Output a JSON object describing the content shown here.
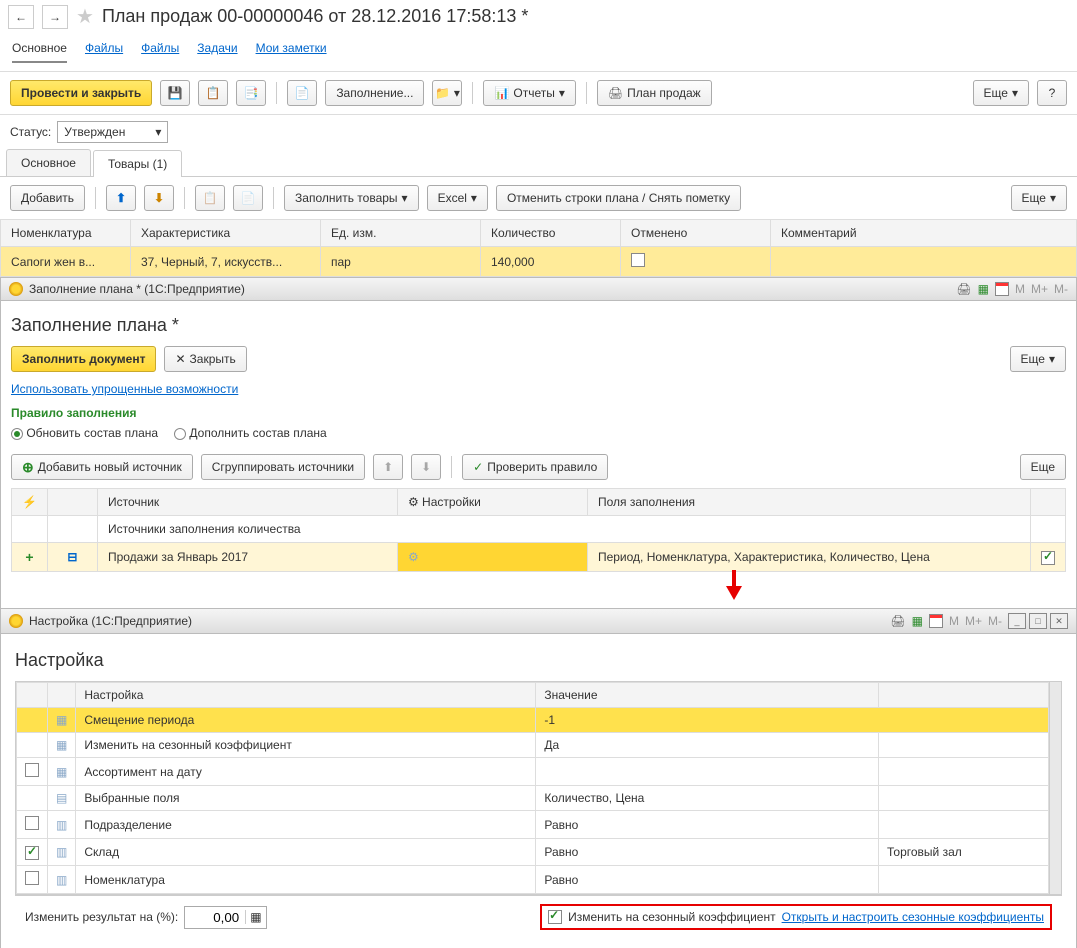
{
  "header": {
    "title": "План продаж 00-00000046 от 28.12.2016 17:58:13 *"
  },
  "sections": {
    "main": "Основное",
    "files1": "Файлы",
    "files2": "Файлы",
    "tasks": "Задачи",
    "notes": "Мои заметки"
  },
  "toolbar1": {
    "post_close": "Провести и закрыть",
    "fill": "Заполнение...",
    "reports": "Отчеты",
    "plan": "План продаж",
    "more": "Еще",
    "help": "?"
  },
  "status": {
    "label": "Статус:",
    "value": "Утвержден"
  },
  "tabs": {
    "main": "Основное",
    "goods": "Товары (1)"
  },
  "goods_toolbar": {
    "add": "Добавить",
    "fill_goods": "Заполнить товары",
    "excel": "Excel",
    "cancel_rows": "Отменить строки плана / Снять пометку",
    "more": "Еще"
  },
  "goods_cols": {
    "nomen": "Номенклатура",
    "char": "Характеристика",
    "unit": "Ед. изм.",
    "qty": "Количество",
    "cancelled": "Отменено",
    "comment": "Комментарий"
  },
  "goods_row": {
    "nomen": "Сапоги жен в...",
    "char": "37, Черный, 7, искусств...",
    "unit": "пар",
    "qty": "140,000"
  },
  "modal1": {
    "title": "Заполнение плана * (1С:Предприятие)",
    "heading": "Заполнение плана *",
    "fill_doc": "Заполнить документ",
    "close": "Закрыть",
    "more": "Еще",
    "simple": "Использовать упрощенные возможности",
    "rule": "Правило заполнения",
    "opt1": "Обновить состав плана",
    "opt2": "Дополнить состав плана",
    "add_src": "Добавить новый источник",
    "group_src": "Сгруппировать источники",
    "check_rule": "Проверить правило"
  },
  "src_cols": {
    "src": "Источник",
    "settings": "Настройки",
    "fields": "Поля заполнения"
  },
  "src_group": "Источники заполнения количества",
  "src_row": {
    "name": "Продажи за Январь 2017",
    "fields": "Период, Номенклатура, Характеристика, Количество, Цена"
  },
  "modal2": {
    "title": "Настройка (1С:Предприятие)",
    "heading": "Настройка",
    "m": "M",
    "mp": "M+",
    "mm": "M-"
  },
  "set_cols": {
    "name": "Настройка",
    "value": "Значение"
  },
  "settings": [
    {
      "name": "Смещение периода",
      "val": "-1",
      "highlight": true
    },
    {
      "name": "Изменить на сезонный коэффициент",
      "val": "Да"
    },
    {
      "name": "Ассортимент на дату",
      "val": "",
      "check": false
    },
    {
      "name": "Выбранные поля",
      "val": "Количество, Цена"
    },
    {
      "name": "Подразделение",
      "val": "Равно",
      "check": false
    },
    {
      "name": "Склад",
      "val": "Равно",
      "val2": "Торговый зал",
      "check": true
    },
    {
      "name": "Номенклатура",
      "val": "Равно",
      "check": false
    }
  ],
  "bottom": {
    "change_label": "Изменить результат на (%):",
    "change_val": "0,00",
    "season_check": "Изменить на сезонный коэффициент",
    "season_link": "Открыть и настроить сезонные коэффициенты"
  }
}
